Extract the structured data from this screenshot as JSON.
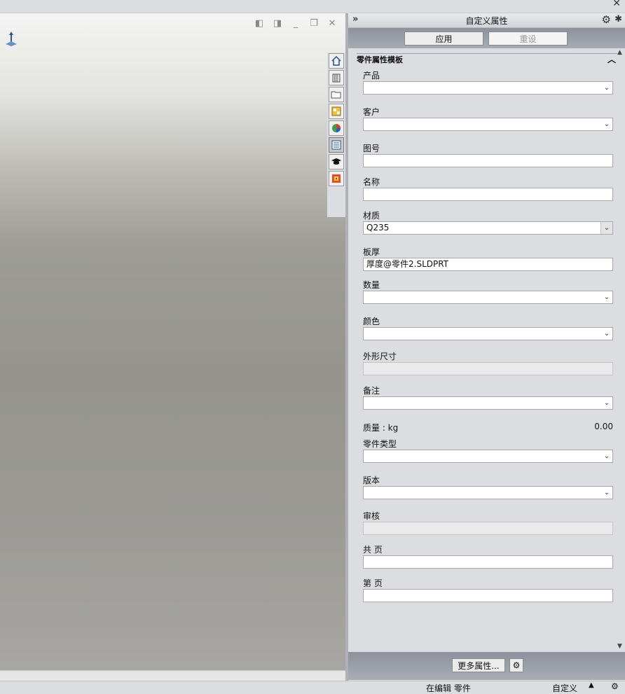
{
  "panel": {
    "title": "自定义属性",
    "apply_label": "应用",
    "reset_label": "重设",
    "group_title": "零件属性模板",
    "more_label": "更多属性..."
  },
  "fields": [
    {
      "label": "产品",
      "value": "",
      "type": "select"
    },
    {
      "label": "客户",
      "value": "",
      "type": "select"
    },
    {
      "label": "图号",
      "value": "",
      "type": "text"
    },
    {
      "label": "名称",
      "value": "",
      "type": "text"
    },
    {
      "label": "材质",
      "value": "Q235",
      "type": "select"
    },
    {
      "label": "板厚",
      "value": "厚度@零件2.SLDPRT",
      "type": "text"
    },
    {
      "label": "数量",
      "value": "",
      "type": "select"
    },
    {
      "label": "颜色",
      "value": "",
      "type": "select"
    },
    {
      "label": "外形尺寸",
      "value": "",
      "type": "disabled"
    },
    {
      "label": "备注",
      "value": "",
      "type": "select"
    },
    {
      "label": "零件类型",
      "value": "",
      "type": "select"
    },
    {
      "label": "版本",
      "value": "",
      "type": "select"
    },
    {
      "label": "审核",
      "value": "",
      "type": "disabled"
    },
    {
      "label": "共 页",
      "value": "",
      "type": "text"
    },
    {
      "label": "第 页",
      "value": "",
      "type": "text"
    }
  ],
  "mass": {
    "label": "质量 : kg",
    "value": "0.00"
  },
  "status": {
    "mode": "在编辑 零件",
    "custom": "自定义"
  }
}
